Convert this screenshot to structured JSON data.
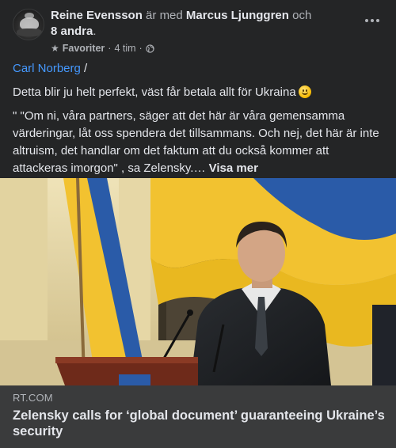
{
  "header": {
    "author": "Reine Evensson",
    "with_text": " är med ",
    "tagged": "Marcus Ljunggren",
    "and_text": " och ",
    "others": "8 andra",
    "period": ".",
    "audience": "Favoriter",
    "time": "4 tim",
    "separator": "·"
  },
  "post": {
    "mention": "Carl Norberg",
    "slash": " /",
    "line1": "Detta blir ju helt perfekt, väst får betala allt för Ukraina",
    "quote": "\" \"Om ni, våra partners, säger att det här är våra gemensamma värderingar, låt oss spendera det tillsammans. Och nej, det här är inte altruism, det handlar om det faktum att du också kommer att attackeras imorgon\" , sa Zelensky.…",
    "see_more": "Visa mer"
  },
  "link_preview": {
    "source": "RT.COM",
    "headline": "Zelensky calls for ‘global document’ guaranteeing Ukraine’s security"
  },
  "icons": [
    "star-icon",
    "globe-icon",
    "more-icon",
    "smile-emoji-icon"
  ],
  "colors": {
    "background": "#242526",
    "link": "#4599ff",
    "preview_background": "#3a3b3c",
    "flag_blue": "#2a5ba8",
    "flag_yellow": "#f2c230"
  }
}
